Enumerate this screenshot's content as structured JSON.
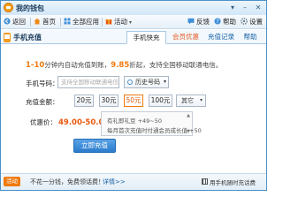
{
  "window": {
    "title": "我的钱包",
    "controls": {
      "menu": "▾",
      "minimize": "–",
      "close": "✕"
    }
  },
  "toolbar": {
    "items": [
      {
        "label": "返回",
        "icon": "back-arrow-icon"
      },
      {
        "label": "首页",
        "icon": "home-icon"
      },
      {
        "label": "全部应用",
        "icon": "grid-icon"
      },
      {
        "label": "活动",
        "icon": "gift-icon"
      }
    ],
    "right": [
      {
        "label": "反馈",
        "icon": "feedback-icon"
      },
      {
        "label": "帮助",
        "icon": "help-icon"
      },
      {
        "label": "设置",
        "icon": "gear-icon"
      }
    ]
  },
  "header": {
    "title": "手机充值",
    "tabs": [
      "手机快充",
      "会员优惠",
      "充值记录",
      "帮助"
    ],
    "active_tab": "手机快充"
  },
  "promo": {
    "highlight_time": "1-10",
    "text_mid": "分钟内自动充值到账，",
    "highlight_discount": "9.85",
    "text_end": "折起，支持全国移动联通电信。"
  },
  "form": {
    "phone_label": "手机号码：",
    "phone_placeholder": "支持全国移动联通电信",
    "history_label": "历史号码",
    "amount_label": "充值金额：",
    "amounts": [
      "20元",
      "30元",
      "50元",
      "100元"
    ],
    "selected_amount": "50元",
    "other_label": "其它",
    "price_label": "优惠价：",
    "price_value": "49.00-50.00元",
    "offers": [
      "有礼即礼豆 +49~50",
      "每月首次充值时付通会员成长值 +50"
    ],
    "submit_label": "立即充值"
  },
  "footer": {
    "badge": "活动",
    "text": "不花一分钱，免费领话费！",
    "link": "详情>>",
    "mobile_pay": "用手机随时充话费"
  },
  "colors": {
    "accent": "#f07a10",
    "price": "#e8560c",
    "primary_button": "#2b7ccc",
    "border": "#4a90c8",
    "link": "#1560a8"
  }
}
